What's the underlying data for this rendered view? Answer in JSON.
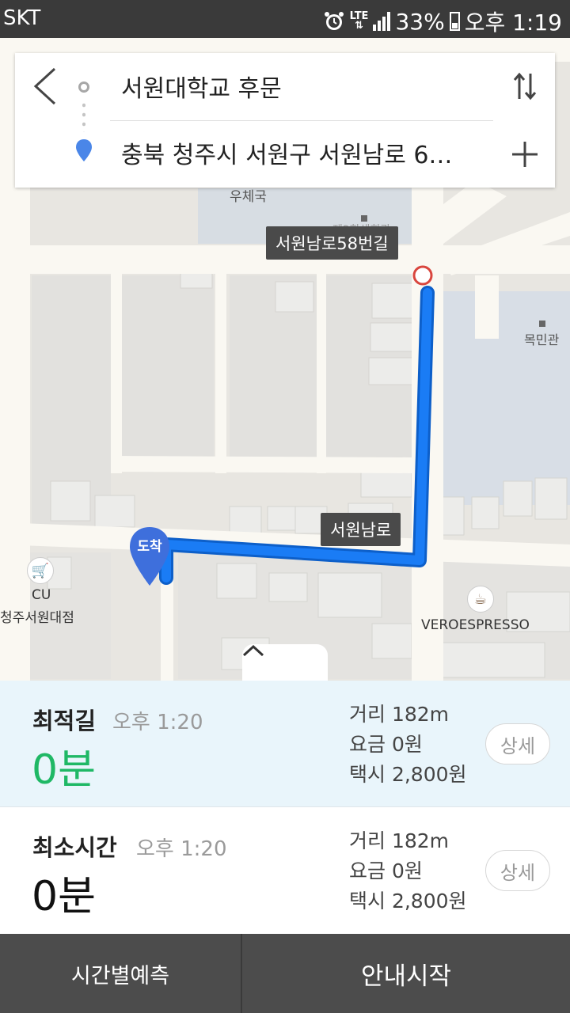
{
  "status_bar": {
    "carrier": "SKT",
    "network": "LTE",
    "battery": "33%",
    "time": "오후 1:19",
    "icons": [
      "alarm-icon",
      "lte-icon",
      "signal-icon",
      "battery-charging-icon"
    ]
  },
  "search": {
    "origin": "서원대학교 후문",
    "destination": "충북 청주시 서원구 서원남로 6…",
    "back_icon": "back-arrow-icon",
    "swap_icon": "swap-icon",
    "add_icon": "plus-icon"
  },
  "map": {
    "labels": {
      "post_office": "우체국",
      "building_blurred": "제2학생회관",
      "mokmin_hall": "목민관",
      "cu_name": "CU",
      "cu_branch": "청주서원대점",
      "cafe": "VEROESPRESSO"
    },
    "road_tags": {
      "road_58": "서원남로58번길",
      "road_main": "서원남로"
    },
    "arrival_pin": "도착",
    "route_color": "#1a7cf5"
  },
  "routes": [
    {
      "name": "최적길",
      "arrival_time": "오후 1:20",
      "duration": "0분",
      "distance": "거리 182m",
      "fee": "요금 0원",
      "taxi": "택시 2,800원",
      "detail_label": "상세",
      "accent": "#1fb865"
    },
    {
      "name": "최소시간",
      "arrival_time": "오후 1:20",
      "duration": "0분",
      "distance": "거리 182m",
      "fee": "요금 0원",
      "taxi": "택시 2,800원",
      "detail_label": "상세"
    }
  ],
  "bottom": {
    "forecast_label": "시간별예측",
    "start_label": "안내시작"
  }
}
